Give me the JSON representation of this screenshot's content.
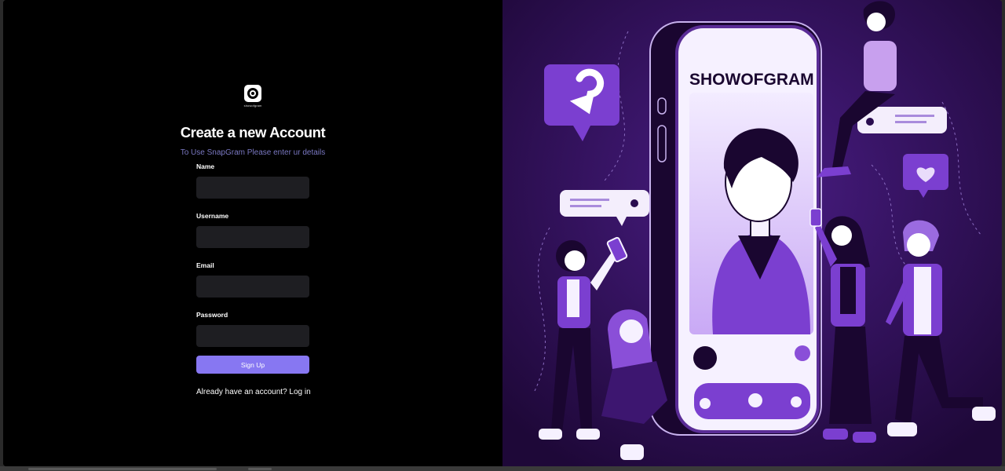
{
  "brand": {
    "logo_text": "showofgram"
  },
  "signup": {
    "title": "Create a new Account",
    "subtitle": "To Use SnapGram Please enter ur details",
    "fields": [
      {
        "label": "Name",
        "value": "",
        "placeholder": ""
      },
      {
        "label": "Username",
        "value": "",
        "placeholder": ""
      },
      {
        "label": "Email",
        "value": "",
        "placeholder": ""
      },
      {
        "label": "Password",
        "value": "",
        "placeholder": ""
      }
    ],
    "submit_label": "Sign Up",
    "login_prompt": "Already have an account?",
    "login_link": "Log in"
  },
  "illustration": {
    "phone_title": "SHOWOFGRAM"
  },
  "colors": {
    "accent": "#8777f2",
    "subtitle": "#7a78c2",
    "input_bg": "#1e1e22",
    "illustration_bg": "#2a0d4f",
    "purple": "#7b3fd0"
  }
}
